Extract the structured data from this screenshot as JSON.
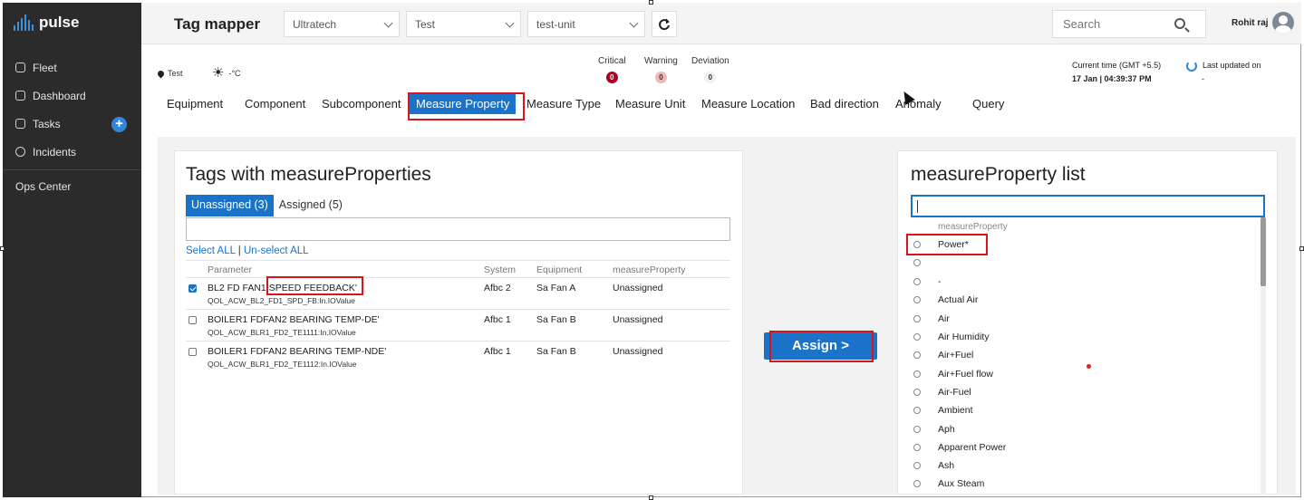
{
  "app": {
    "logo_text": "pulse",
    "page_title": "Tag mapper",
    "brand_color": "#1a73c9",
    "sidebar_bg": "#2b2b2b"
  },
  "sidebar": {
    "items": [
      {
        "label": "Fleet",
        "icon": "fleet-icon"
      },
      {
        "label": "Dashboard",
        "icon": "dashboard-icon"
      },
      {
        "label": "Tasks",
        "icon": "tasks-icon"
      },
      {
        "label": "Incidents",
        "icon": "info-icon"
      }
    ],
    "ops_center": "Ops Center"
  },
  "filters": {
    "company": "Ultratech",
    "plant": "Test",
    "unit": "test-unit"
  },
  "search": {
    "placeholder": "Search"
  },
  "user": {
    "name": "Rohit raj"
  },
  "info": {
    "location": "Test",
    "temperature": "-°C",
    "critical_label": "Critical",
    "critical_count": "0",
    "warning_label": "Warning",
    "warning_count": "0",
    "deviation_label": "Deviation",
    "deviation_count": "0",
    "current_time_label": "Current time (GMT +5.5)",
    "current_time_value": "17 Jan | 04:39:37 PM",
    "last_updated_label": "Last updated on",
    "last_updated_value": "-"
  },
  "tabs": [
    "Equipment",
    "Component",
    "Subcomponent",
    "Measure Property",
    "Measure Type",
    "Measure Unit",
    "Measure Location",
    "Bad direction",
    "Anomaly",
    "Query"
  ],
  "left_panel": {
    "title": "Tags with measureProperties",
    "tab_unassigned": "Unassigned (3)",
    "tab_assigned": "Assigned (5)",
    "select_all": "Select ALL",
    "separator": "|",
    "unselect_all": "Un-select ALL",
    "columns": [
      "Parameter",
      "System",
      "Equipment",
      "measureProperty"
    ],
    "rows": [
      {
        "checked": true,
        "param_prefix": "BL2 FD FAN1 ",
        "param_highlight": "SPEED FEEDBACK'",
        "tag": "QOL_ACW_BL2_FD1_SPD_FB:In.IOValue",
        "system": "Afbc 2",
        "equipment": "Sa Fan A",
        "measure_property": "Unassigned"
      },
      {
        "checked": false,
        "param_prefix": "BOILER1 FDFAN2 BEARING TEMP-DE'",
        "param_highlight": "",
        "tag": "QOL_ACW_BLR1_FD2_TE1111:In.IOValue",
        "system": "Afbc 1",
        "equipment": "Sa Fan B",
        "measure_property": "Unassigned"
      },
      {
        "checked": false,
        "param_prefix": "BOILER1 FDFAN2 BEARING TEMP-NDE'",
        "param_highlight": "",
        "tag": "QOL_ACW_BLR1_FD2_TE1112:In.IOValue",
        "system": "Afbc 1",
        "equipment": "Sa Fan B",
        "measure_property": "Unassigned"
      }
    ]
  },
  "assign_button": "Assign >",
  "right_panel": {
    "title": "measureProperty list",
    "header": "measureProperty",
    "items": [
      "Power*",
      "",
      "-",
      "Actual Air",
      "Air",
      "Air Humidity",
      "Air+Fuel",
      "Air+Fuel flow",
      "Air-Fuel",
      "Ambient",
      "Aph",
      "Apparent Power",
      "Ash",
      "Aux Steam"
    ]
  }
}
